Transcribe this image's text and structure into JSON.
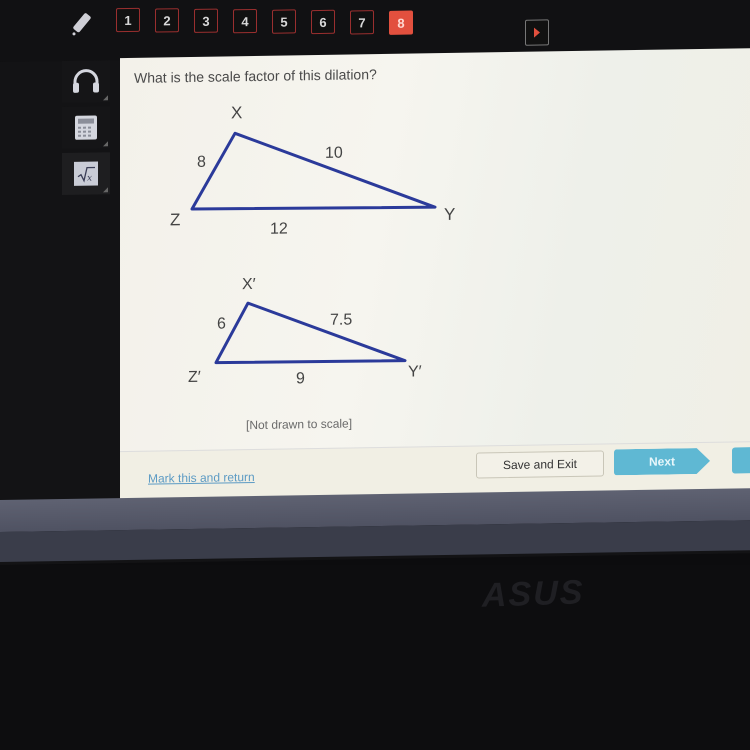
{
  "toolbar": {
    "icons": [
      "pencil-icon",
      "headphones-icon",
      "calculator-icon",
      "square-root-icon"
    ],
    "question_numbers": [
      "1",
      "2",
      "3",
      "4",
      "5",
      "6",
      "7",
      "8"
    ],
    "active_question": "8",
    "next_question_icon": "play-arrow-icon"
  },
  "question": {
    "prompt": "What is the scale factor of this dilation?",
    "figure": {
      "triangle_original": {
        "vertices": {
          "X": "X",
          "Y": "Y",
          "Z": "Z"
        },
        "sides": {
          "ZX": "8",
          "XY": "10",
          "ZY": "12"
        }
      },
      "triangle_image": {
        "vertices": {
          "X": "X′",
          "Y": "Y′",
          "Z": "Z′"
        },
        "sides": {
          "ZX": "6",
          "XY": "7.5",
          "ZY": "9"
        }
      },
      "stroke_color": "#2b3a9a"
    },
    "caption": "[Not drawn to scale]"
  },
  "footer": {
    "mark_link": "Mark this and return",
    "save_exit": "Save and Exit",
    "next": "Next"
  },
  "colors": {
    "active_question": "#e2503e",
    "next_button": "#5fb8d3",
    "link": "#5d9bc4"
  },
  "device": {
    "brand": "ASUS"
  }
}
